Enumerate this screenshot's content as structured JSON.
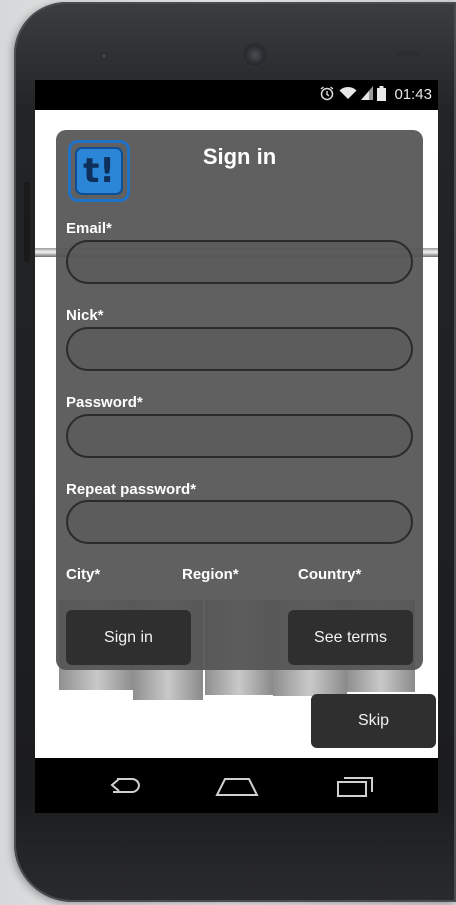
{
  "status_bar": {
    "alarm_icon": "alarm-clock-icon",
    "wifi_icon": "wifi-icon",
    "signal_icon": "cell-signal-icon",
    "battery_icon": "battery-icon",
    "time": "01:43"
  },
  "signin_form": {
    "title": "Sign in",
    "logo_text": "t!",
    "fields": {
      "email_label": "Email*",
      "nick_label": "Nick*",
      "password_label": "Password*",
      "repeat_password_label": "Repeat password*"
    },
    "location": {
      "city_label": "City*",
      "region_label": "Region*",
      "country_label": "Country*"
    },
    "signin_button": "Sign in",
    "see_terms_button": "See terms"
  },
  "skip_button": "Skip",
  "nav_bar": {
    "back_icon": "back-icon",
    "home_icon": "home-icon",
    "recents_icon": "recent-apps-icon"
  },
  "colors": {
    "logo_blue": "#2b86d8",
    "card_bg": "#545454",
    "button_bg": "#2f2f2f"
  }
}
